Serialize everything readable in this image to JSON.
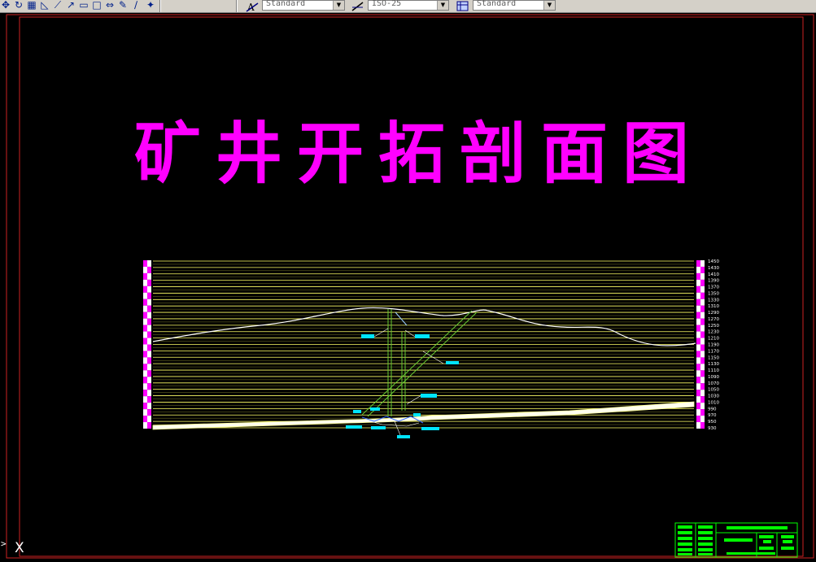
{
  "toolbar": {
    "icons": [
      "pan-icon",
      "orbit-icon",
      "window-icon",
      "dimension-icon",
      "line-icon",
      "arrow-icon",
      "rectangle-icon",
      "square-icon",
      "move-icon",
      "pencil-icon",
      "brush-icon",
      "wand-icon"
    ],
    "text_style": "Standard",
    "dim_style": "ISO-25",
    "table_style": "Standard"
  },
  "drawing": {
    "title": "矿井开拓剖面图",
    "elevation_labels": [
      "1450",
      "1430",
      "1410",
      "1390",
      "1370",
      "1350",
      "1330",
      "1310",
      "1290",
      "1270",
      "1250",
      "1230",
      "1210",
      "1190",
      "1170",
      "1150",
      "1130",
      "1110",
      "1090",
      "1070",
      "1050",
      "1030",
      "1010",
      "990",
      "970",
      "950",
      "930"
    ]
  },
  "colors": {
    "title": "#ff00ff",
    "grid_lines": "#ffff66",
    "terrain": "#ffffff",
    "shaft": "#66cc33",
    "labels": "#00e5ff",
    "title_block": "#00ff00"
  },
  "command_line": {
    "prompt": ">",
    "axis_mark": "X"
  }
}
